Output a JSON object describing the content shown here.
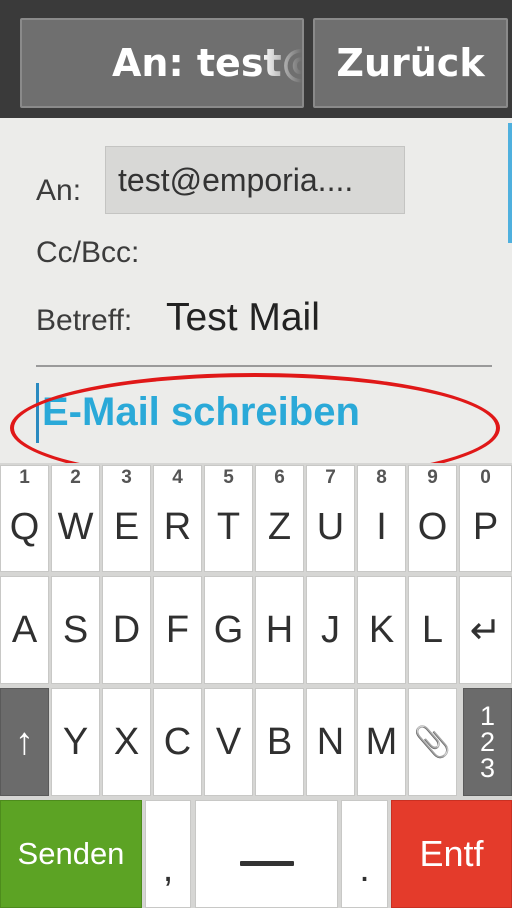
{
  "header": {
    "to_title": "An: test@",
    "back_label": "Zurück"
  },
  "compose": {
    "to_label": "An:",
    "to_value": "test@emporia....",
    "cc_label": "Cc/Bcc:",
    "subject_label": "Betreff:",
    "subject_value": "Test Mail",
    "body_placeholder": "E-Mail schreiben"
  },
  "keyboard": {
    "row1": [
      {
        "num": "1",
        "letter": "Q"
      },
      {
        "num": "2",
        "letter": "W"
      },
      {
        "num": "3",
        "letter": "E"
      },
      {
        "num": "4",
        "letter": "R"
      },
      {
        "num": "5",
        "letter": "T"
      },
      {
        "num": "6",
        "letter": "Z"
      },
      {
        "num": "7",
        "letter": "U"
      },
      {
        "num": "8",
        "letter": "I"
      },
      {
        "num": "9",
        "letter": "O"
      },
      {
        "num": "0",
        "letter": "P"
      }
    ],
    "row2": [
      "A",
      "S",
      "D",
      "F",
      "G",
      "H",
      "J",
      "K",
      "L"
    ],
    "enter_symbol": "↵",
    "shift_symbol": "↑",
    "row3": [
      "Y",
      "X",
      "C",
      "V",
      "B",
      "N",
      "M"
    ],
    "attach_symbol": "📎",
    "numbers_toggle": [
      "1",
      "2",
      "3"
    ],
    "send_label": "Senden",
    "comma": ",",
    "period": ".",
    "delete_label": "Entf"
  },
  "colors": {
    "accent": "#2aa9d8",
    "send": "#5ca324",
    "delete": "#e43b2b",
    "highlight": "#e01818"
  }
}
